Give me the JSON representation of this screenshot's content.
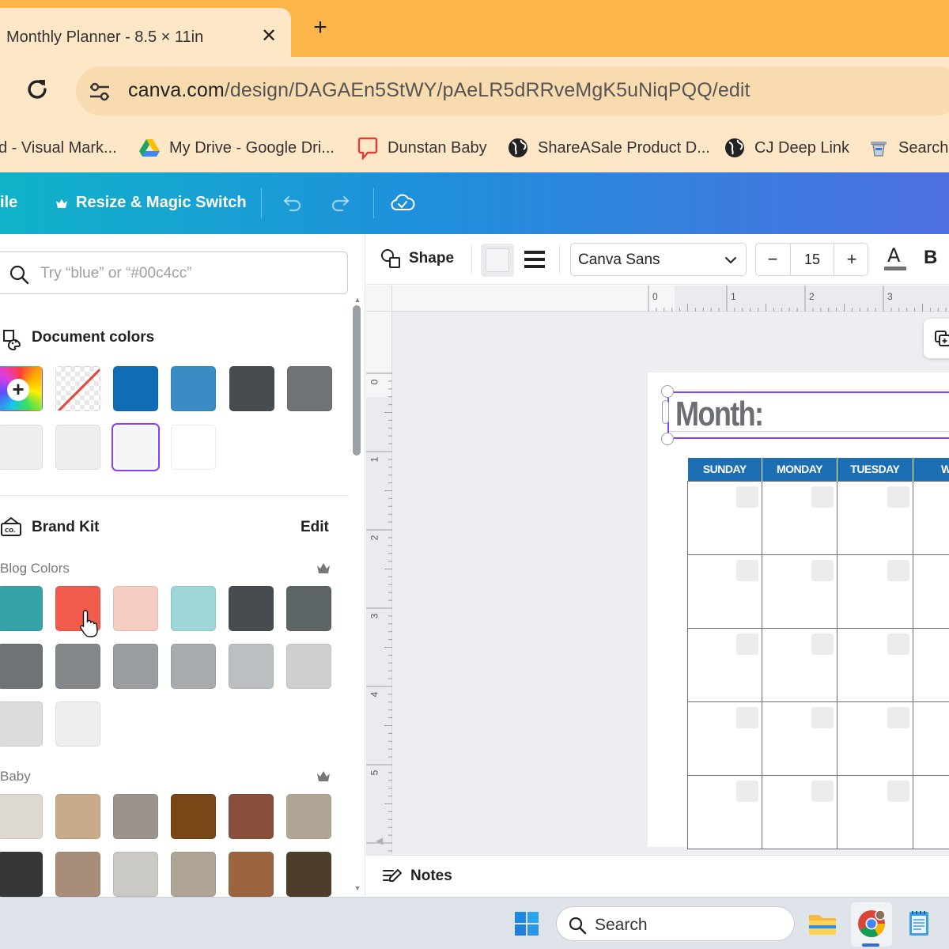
{
  "browser": {
    "tab_title": "Monthly Planner - 8.5 × 11in",
    "close_glyph": "✕",
    "new_tab_glyph": "+",
    "url_host": "canva.com",
    "url_path": "/design/DAGAEn5StWY/pAeLR5dRRveMgK5uNiqPQQ/edit",
    "bookmarks": [
      {
        "label": "d - Visual Mark...",
        "icon": "none"
      },
      {
        "label": "My Drive - Google Dri...",
        "icon": "google-drive-icon"
      },
      {
        "label": "Dunstan Baby",
        "icon": "chat-bubble-icon"
      },
      {
        "label": "ShareASale Product D...",
        "icon": "globe-icon"
      },
      {
        "label": "CJ Deep Link",
        "icon": "globe-icon"
      },
      {
        "label": "Search",
        "icon": "search-bookmark-icon"
      }
    ]
  },
  "canva_header": {
    "file_label": "ile",
    "resize_label": "Resize & Magic Switch"
  },
  "color_panel": {
    "search_placeholder": "Try “blue” or “#00c4cc”",
    "document_colors_title": "Document colors",
    "document_colors": [
      "#0f6cb5",
      "#3a8cc4",
      "#464c50",
      "#6f7376",
      "#eeeff0",
      "#eeeff0",
      "#f4f5f6",
      "#ffffff"
    ],
    "brand_kit_title": "Brand Kit",
    "edit_label": "Edit",
    "blog_colors_title": "Blog Colors",
    "blog_colors": [
      "#35a3a8",
      "#f05b4c",
      "#f6cdc3",
      "#9fd6d8",
      "#464c50",
      "#5c6466",
      "#6e7376",
      "#85888b",
      "#9a9ea1",
      "#a8acaf",
      "#bcbfc1",
      "#cdcfd1",
      "#dcdcdc",
      "#eeefef"
    ],
    "baby_title": "Baby",
    "baby_colors": [
      "#dedad3",
      "#c7ab8a",
      "#9b948d",
      "#774717",
      "#8a4f3c",
      "#b1a596",
      "#363636",
      "#a88e78",
      "#cbc9c4",
      "#aea597",
      "#9c6540",
      "#4d3e2c"
    ]
  },
  "context_toolbar": {
    "shape_label": "Shape",
    "font_name": "Canva Sans",
    "minus_glyph": "−",
    "font_size": "15",
    "plus_glyph": "+",
    "bold_label": "B"
  },
  "rulers": {
    "top": [
      "0",
      "1",
      "2",
      "3"
    ],
    "left": [
      "0",
      "1",
      "2",
      "3",
      "4",
      "5"
    ]
  },
  "design": {
    "month_label": "Month:",
    "weekdays": [
      "SUNDAY",
      "MONDAY",
      "TUESDAY",
      "W"
    ],
    "week_rows": 5,
    "header_color": "#1d6fb4"
  },
  "footer": {
    "notes_label": "Notes"
  },
  "taskbar": {
    "search_label": "Search"
  }
}
